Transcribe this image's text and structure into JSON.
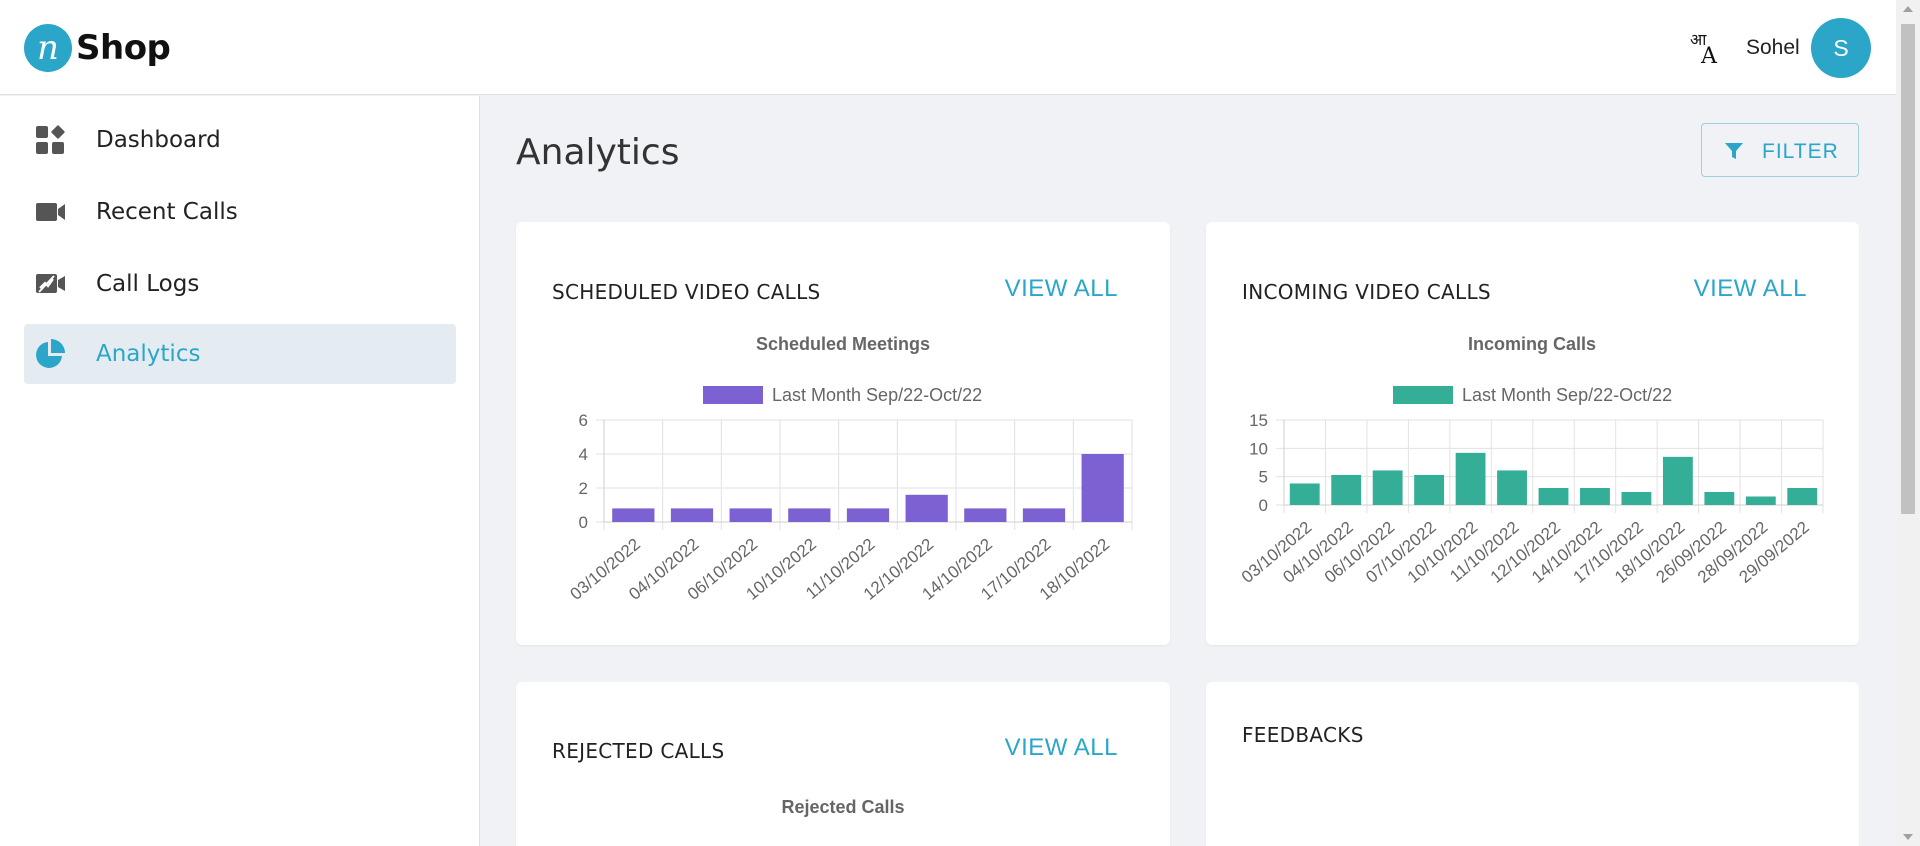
{
  "app": {
    "logo_mark": "n",
    "logo_text": "Shop"
  },
  "header": {
    "language_icon": "translate-icon",
    "user_name": "Sohel",
    "avatar_initial": "S"
  },
  "sidebar": {
    "items": [
      {
        "label": "Dashboard",
        "icon": "dashboard-icon",
        "active": false
      },
      {
        "label": "Recent Calls",
        "icon": "video-camera-icon",
        "active": false
      },
      {
        "label": "Call Logs",
        "icon": "call-log-icon",
        "active": false
      },
      {
        "label": "Analytics",
        "icon": "pie-chart-icon",
        "active": true
      }
    ]
  },
  "main": {
    "title": "Analytics",
    "filter_label": "FILTER",
    "cards": [
      {
        "title": "SCHEDULED VIDEO CALLS",
        "action": "VIEW ALL"
      },
      {
        "title": "INCOMING VIDEO CALLS",
        "action": "VIEW ALL"
      },
      {
        "title": "REJECTED CALLS",
        "action": "VIEW ALL",
        "chart_title": "Rejected Calls"
      },
      {
        "title": "FEEDBACKS"
      }
    ]
  },
  "colors": {
    "accent": "#2ba6c9",
    "scheduled_bar": "#7b61d1",
    "incoming_bar": "#35ae98"
  },
  "chart_data": [
    {
      "type": "bar",
      "title": "Scheduled Meetings",
      "categories": [
        "03/10/2022",
        "04/10/2022",
        "06/10/2022",
        "10/10/2022",
        "11/10/2022",
        "12/10/2022",
        "14/10/2022",
        "17/10/2022",
        "18/10/2022"
      ],
      "series": [
        {
          "name": "Last Month Sep/22-Oct/22",
          "values": [
            0.8,
            0.8,
            0.8,
            0.8,
            0.8,
            1.6,
            0.8,
            0.8,
            4
          ],
          "color": "#7b61d1"
        }
      ],
      "ylim": [
        0,
        6
      ],
      "yticks": [
        0,
        2,
        4,
        6
      ],
      "grid": true,
      "legend": "top-center"
    },
    {
      "type": "bar",
      "title": "Incoming Calls",
      "categories": [
        "03/10/2022",
        "04/10/2022",
        "06/10/2022",
        "07/10/2022",
        "10/10/2022",
        "11/10/2022",
        "12/10/2022",
        "14/10/2022",
        "17/10/2022",
        "18/10/2022",
        "26/09/2022",
        "28/09/2022",
        "29/09/2022"
      ],
      "series": [
        {
          "name": "Last Month Sep/22-Oct/22",
          "values": [
            3.8,
            5.3,
            6.1,
            5.3,
            9.2,
            6.1,
            3,
            3,
            2.3,
            8.5,
            2.3,
            1.5,
            3
          ],
          "color": "#35ae98"
        }
      ],
      "ylim": [
        0,
        15
      ],
      "yticks": [
        0,
        5,
        10,
        15
      ],
      "grid": true,
      "legend": "top-center"
    }
  ]
}
